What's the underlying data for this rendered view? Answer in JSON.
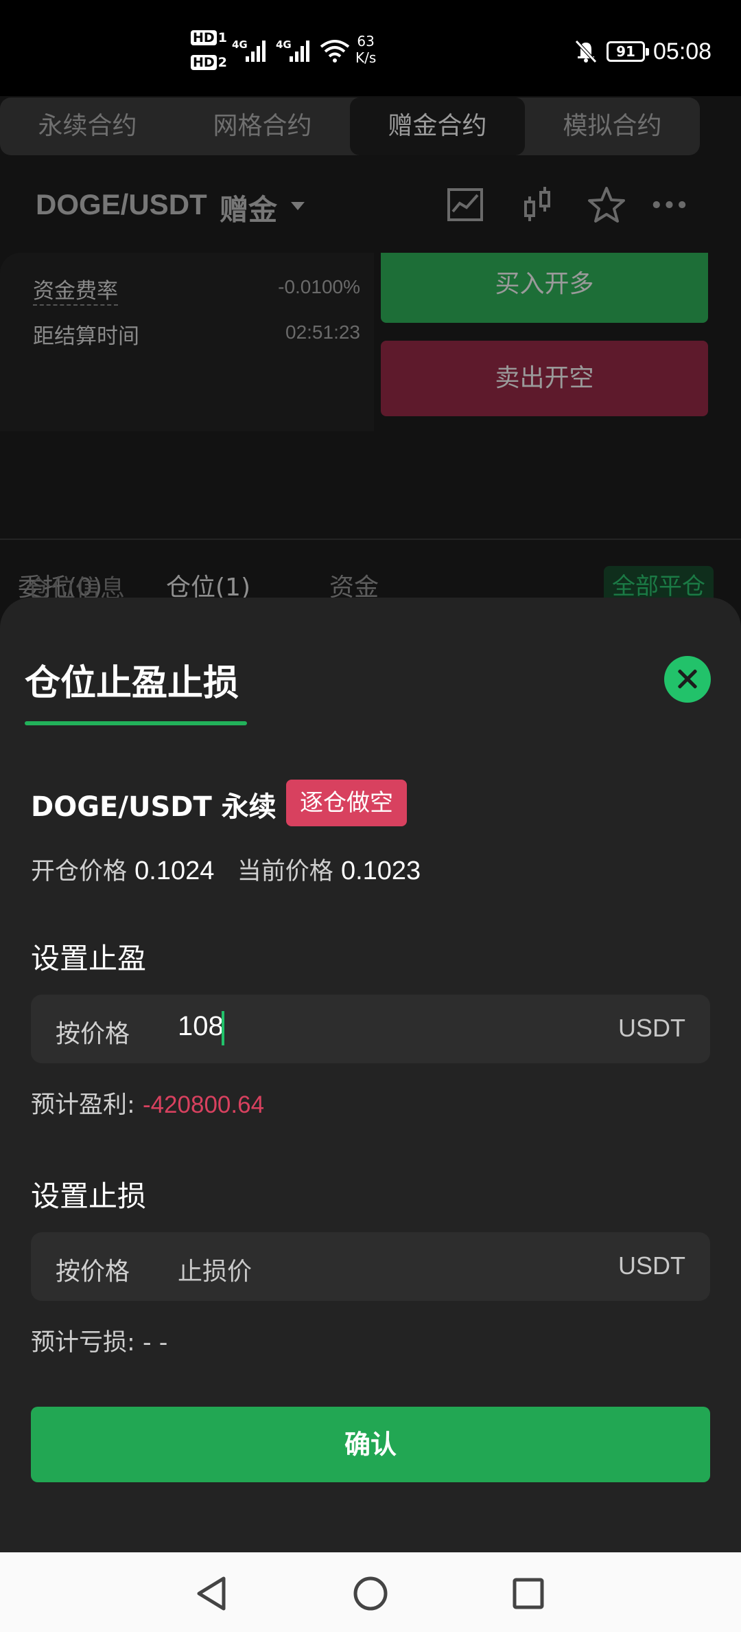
{
  "status_bar": {
    "hd1": "HD",
    "hd1_sub": "1",
    "hd2": "HD",
    "hd2_sub": "2",
    "sig1": "4G",
    "sig2": "4G",
    "speed_value": "63",
    "speed_unit": "K/s",
    "battery": "91",
    "time": "05:08"
  },
  "contract_tabs": [
    "永续合约",
    "网格合约",
    "赠金合约",
    "模拟合约"
  ],
  "active_tab": "赠金合约",
  "pair_header": {
    "pair": "DOGE/USDT",
    "mode": "赠金",
    "icons": [
      "chart-line-icon",
      "candlestick-icon",
      "star-icon",
      "more-icon"
    ]
  },
  "info": {
    "funding_rate_label": "资金费率",
    "funding_rate_value": "-0.0100%",
    "settle_label": "距结算时间",
    "settle_value": "02:51:23",
    "buy_label": "买入开多",
    "sell_label": "卖出开空"
  },
  "order_tabs": {
    "orders": "委托(0)",
    "positions": "仓位(1)",
    "funds": "资金"
  },
  "position_info_label": "仓位信息",
  "close_all_label": "全部平仓",
  "sheet": {
    "title": "仓位止盈止损",
    "contract": "DOGE/USDT 永续",
    "badge": "逐仓做空",
    "open_price_label": "开仓价格",
    "open_price": "0.1024",
    "current_price_label": "当前价格",
    "current_price": "0.1023",
    "tp": {
      "title": "设置止盈",
      "label": "按价格",
      "value": "108",
      "unit": "USDT",
      "est_label": "预计盈利:",
      "est_value": "-420800.64"
    },
    "sl": {
      "title": "设置止损",
      "label": "按价格",
      "placeholder": "止损价",
      "unit": "USDT",
      "est_label": "预计亏损:",
      "est_value": "- -"
    },
    "confirm": "确认"
  },
  "colors": {
    "accent_green": "#22a753",
    "danger_red": "#d8415f",
    "sheet_bg": "#232323"
  }
}
